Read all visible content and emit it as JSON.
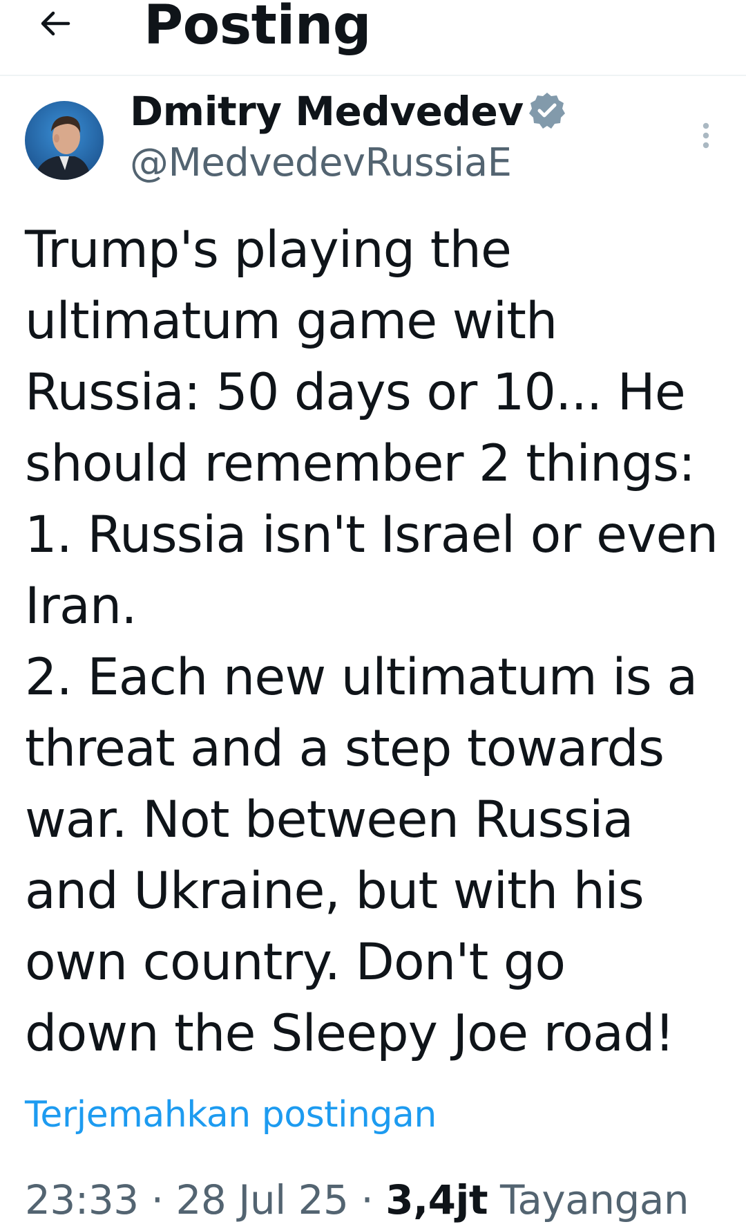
{
  "header": {
    "title": "Posting",
    "back_icon": "arrow-left-icon"
  },
  "author": {
    "name": "Dmitry Medvedev",
    "handle": "@MedvedevRussiaE",
    "verified_icon": "verified-badge-icon",
    "verified_color": "#829aab"
  },
  "more_icon": "more-vertical-icon",
  "post": {
    "lines": [
      "Trump's playing the",
      "ultimatum game with",
      "Russia: 50 days or 10... He",
      "should remember 2 things:",
      "1. Russia isn't Israel or even",
      "Iran.",
      "2. Each new ultimatum is a",
      "threat and a step towards",
      "war. Not between Russia",
      "and Ukraine, but with his",
      "own country. Don't go",
      "down the Sleepy Joe road!"
    ]
  },
  "translate_label": "Terjemahkan postingan",
  "meta": {
    "time": "23:33",
    "separator": "·",
    "date": "28 Jul 25",
    "views_count": "3,4jt",
    "views_label": "Tayangan"
  },
  "colors": {
    "link": "#1d9bf0",
    "secondary_text": "#536471",
    "primary_text": "#0f1419"
  }
}
